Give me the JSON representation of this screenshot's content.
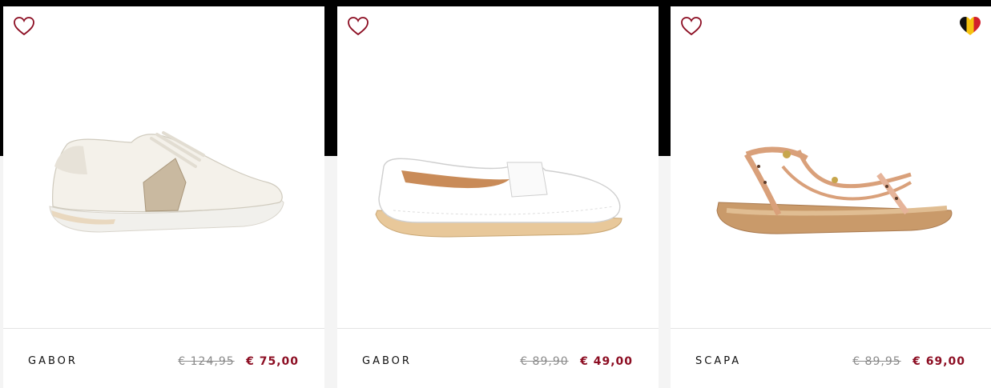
{
  "products": [
    {
      "brand": "GABOR",
      "old_price": "€ 124,95",
      "new_price": "€ 75,00",
      "image_icon": "white-sneaker-image",
      "favorite_icon": "heart-outline-icon"
    },
    {
      "brand": "GABOR",
      "old_price": "€ 89,90",
      "new_price": "€ 49,00",
      "image_icon": "white-loafer-image",
      "favorite_icon": "heart-outline-icon"
    },
    {
      "brand": "SCAPA",
      "old_price": "€ 89,95",
      "new_price": "€ 69,00",
      "image_icon": "leopard-sandal-image",
      "favorite_icon": "heart-outline-icon",
      "badge_icon": "belgian-flag-heart-icon"
    }
  ],
  "colors": {
    "sale_price": "#8c0d22",
    "heart": "#8c0d22",
    "old_price": "#8a8a8a"
  }
}
